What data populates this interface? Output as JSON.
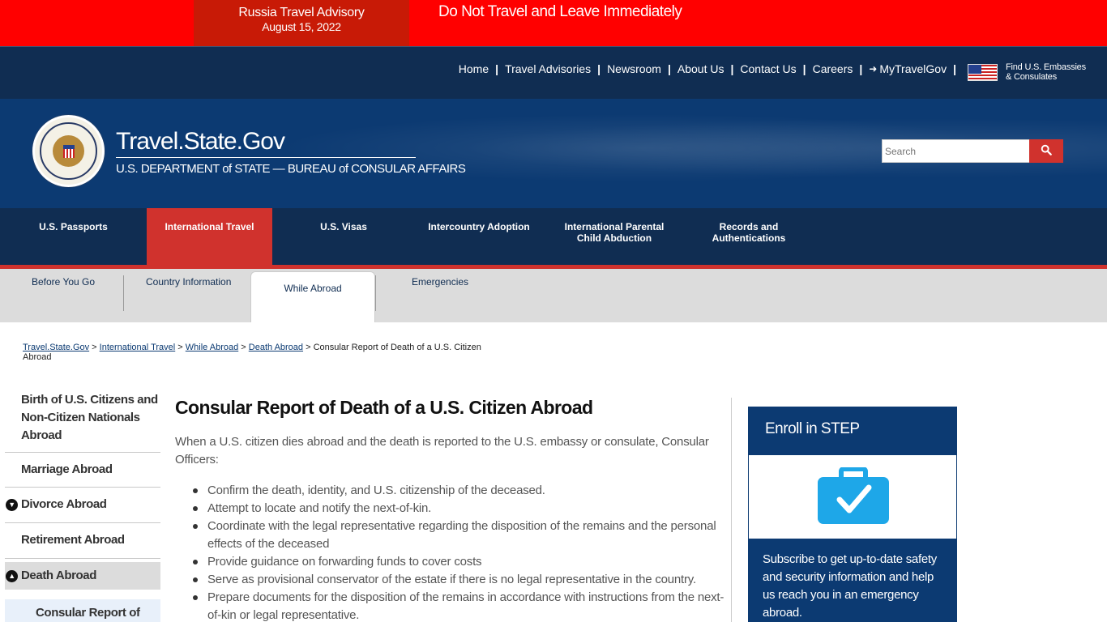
{
  "alert": {
    "title": "Russia Travel Advisory",
    "date": "August 15, 2022",
    "message": "Do Not Travel and Leave Immediately"
  },
  "utility_nav": {
    "links": [
      "Home",
      "Travel Advisories",
      "Newsroom",
      "About Us",
      "Contact Us",
      "Careers",
      "MyTravelGov"
    ],
    "embassy_line1": "Find U.S. Embassies",
    "embassy_line2": "& Consulates"
  },
  "header": {
    "title": "Travel.State.Gov",
    "subtitle": "U.S. DEPARTMENT of STATE — BUREAU of CONSULAR AFFAIRS",
    "search_placeholder": "Search"
  },
  "main_nav": [
    {
      "label": "U.S. Passports",
      "active": false
    },
    {
      "label": "International Travel",
      "active": true
    },
    {
      "label": "U.S. Visas",
      "active": false
    },
    {
      "label": "Intercountry Adoption",
      "active": false
    },
    {
      "label": "International Parental Child Abduction",
      "active": false
    },
    {
      "label": "Records and Authentications",
      "active": false
    }
  ],
  "sub_nav": [
    "Before You Go",
    "Country Information",
    "While Abroad",
    "Emergencies"
  ],
  "breadcrumb": {
    "links": [
      "Travel.State.Gov",
      "International Travel",
      "While Abroad",
      "Death Abroad"
    ],
    "current": "Consular Report of Death of a U.S. Citizen Abroad"
  },
  "sidebar": [
    "Birth of U.S. Citizens and Non-Citizen Nationals Abroad",
    "Marriage Abroad",
    "Divorce Abroad",
    "Retirement Abroad",
    "Death Abroad",
    "Consular Report of"
  ],
  "content": {
    "title": "Consular Report of Death of a U.S. Citizen Abroad",
    "intro": "When a U.S. citizen dies abroad and the death is reported to the U.S. embassy or consulate, Consular Officers:",
    "bullets": [
      "Confirm the death, identity, and U.S. citizenship of the deceased.",
      "Attempt to locate and notify the next-of-kin.",
      "Coordinate with the legal representative regarding the disposition of the remains and the personal effects of the deceased",
      "Provide guidance on forwarding funds to cover costs",
      "Serve as provisional conservator of the estate if there is no legal representative in the country.",
      "Prepare documents for the disposition of the remains in accordance with instructions from the next-of-kin or legal representative."
    ]
  },
  "step": {
    "title": "Enroll in STEP",
    "icon": "briefcase-check-icon",
    "text": "Subscribe to get up-to-date safety and security information and help us reach you in an emergency abroad."
  },
  "colors": {
    "alert_red": "#ff0000",
    "navy": "#102d52",
    "active_red": "#d0322d",
    "step_icon": "#1ea7e8"
  }
}
